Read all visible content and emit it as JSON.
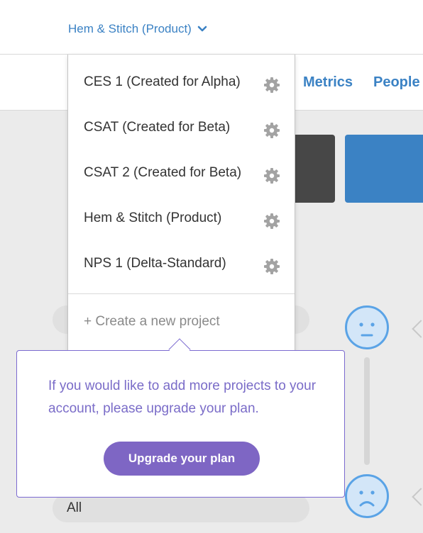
{
  "header": {
    "project_selector_label": "Hem & Stitch (Product)"
  },
  "nav": {
    "metrics_label": "Metrics",
    "people_label": "People"
  },
  "dropdown": {
    "items": [
      {
        "label": "CES 1 (Created for Alpha)"
      },
      {
        "label": "CSAT (Created for Beta)"
      },
      {
        "label": "CSAT 2 (Created for Beta)"
      },
      {
        "label": "Hem & Stitch (Product)"
      },
      {
        "label": "NPS 1 (Delta-Standard)"
      }
    ],
    "create_label": "+ Create a new project"
  },
  "tooltip": {
    "message": "If you would like to add more projects to your account, please upgrade your plan.",
    "button_label": "Upgrade your plan"
  },
  "filter": {
    "value": "All"
  },
  "colors": {
    "accent_blue": "#3b82c4",
    "upgrade_purple": "#7e66c4",
    "tooltip_text": "#7a6cc8"
  }
}
